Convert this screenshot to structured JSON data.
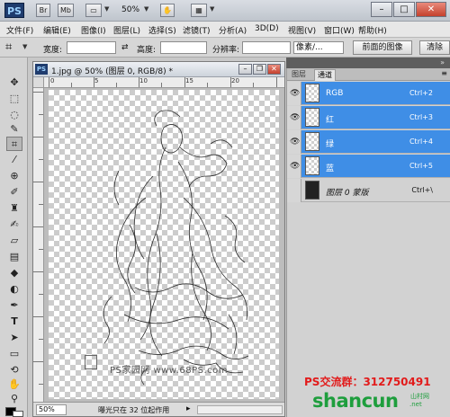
{
  "app": {
    "logo": "PS",
    "bridge_btn": "Br",
    "minibridge_btn": "Mb",
    "zoom": "50%"
  },
  "menu": [
    "文件(F)",
    "编辑(E)",
    "图像(I)",
    "图层(L)",
    "选择(S)",
    "滤镜(T)",
    "分析(A)",
    "3D(D)",
    "视图(V)",
    "窗口(W)",
    "帮助(H)"
  ],
  "options": {
    "width_label": "宽度:",
    "height_label": "高度:",
    "resolution_label": "分辨率:",
    "unit_select": "像素/...",
    "front_image_btn": "前面的图像",
    "clear_btn": "清除"
  },
  "document": {
    "title": "1.jpg @ 50% (图层 0, RGB/8) *",
    "ruler_numbers": [
      "0",
      "5",
      "10",
      "15",
      "20"
    ],
    "watermark": "PS家园网 www.68PS.com",
    "status_zoom": "50%",
    "status_text": "曝光只在 32 位起作用"
  },
  "panel": {
    "tabs": [
      "图层",
      "通道"
    ],
    "active_tab": "通道",
    "channels": [
      {
        "name": "RGB",
        "shortcut": "Ctrl+2",
        "selected": true,
        "visible": true
      },
      {
        "name": "红",
        "shortcut": "Ctrl+3",
        "selected": true,
        "visible": true
      },
      {
        "name": "绿",
        "shortcut": "Ctrl+4",
        "selected": true,
        "visible": true
      },
      {
        "name": "蓝",
        "shortcut": "Ctrl+5",
        "selected": true,
        "visible": true
      },
      {
        "name": "图层 0 蒙版",
        "shortcut": "Ctrl+\\",
        "selected": false,
        "visible": false
      }
    ]
  },
  "overlay": {
    "qq_group": "PS交流群：312750491",
    "site_logo": "shancun",
    "site_sub1": "山村网",
    "site_sub2": ".net"
  }
}
